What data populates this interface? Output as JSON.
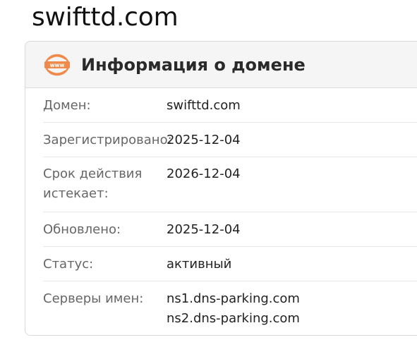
{
  "page": {
    "title": "swifttd.com"
  },
  "card": {
    "icon": "www-globe-icon",
    "icon_text": "www",
    "title": "Информация о домене",
    "accent_color": "#f08a4b"
  },
  "rows": {
    "domain": {
      "label": "Домен:",
      "value": "swifttd.com"
    },
    "registered": {
      "label": "Зарегистрировано:",
      "value": "2025-12-04"
    },
    "expires": {
      "label": "Срок действия истекает:",
      "value": "2026-12-04"
    },
    "updated": {
      "label": "Обновлено:",
      "value": "2025-12-04"
    },
    "status": {
      "label": "Статус:",
      "value": "активный"
    },
    "nameservers": {
      "label": "Серверы имен:",
      "values": [
        "ns1.dns-parking.com",
        "ns2.dns-parking.com"
      ]
    }
  }
}
